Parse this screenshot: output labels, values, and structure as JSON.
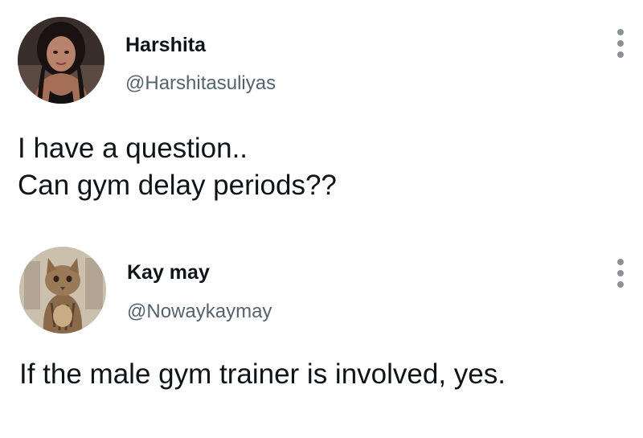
{
  "tweets": [
    {
      "name": "Harshita",
      "handle": "@Harshitasuliyas",
      "avatar_icon": "profile-photo-woman",
      "text_lines": [
        "I have a question..",
        "Can gym delay periods??"
      ],
      "more_icon": "vertical-ellipsis-icon"
    },
    {
      "name": "Kay may",
      "handle": "@Nowaykaymay",
      "avatar_icon": "profile-photo-cat",
      "text_lines": [
        "If the male gym trainer is involved, yes."
      ],
      "more_icon": "vertical-ellipsis-icon"
    }
  ],
  "colors": {
    "name": "#0f1419",
    "handle": "#536471",
    "more_dots": "#8a9198",
    "background": "#ffffff"
  }
}
